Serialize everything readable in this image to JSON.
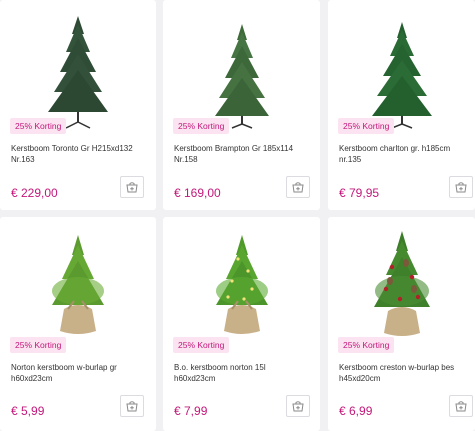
{
  "products": [
    {
      "name": "Kerstboom Toronto Gr H215xd132 Nr.163",
      "price": "€ 229,00",
      "badge": "25% Korting",
      "image": "artificial-christmas-tree-dark"
    },
    {
      "name": "Kerstboom Brampton Gr 185x114 Nr.158",
      "price": "€ 169,00",
      "badge": "25% Korting",
      "image": "artificial-christmas-tree"
    },
    {
      "name": "Kerstboom charlton gr. h185cm nr.135",
      "price": "€ 79,95",
      "badge": "25% Korting",
      "image": "artificial-christmas-tree"
    },
    {
      "name": "Norton kerstboom w-burlap gr h60xd23cm",
      "price": "€ 5,99",
      "badge": "25% Korting",
      "image": "mini-tree-burlap"
    },
    {
      "name": "B.o. kerstboom norton 15l h60xd23cm",
      "price": "€ 7,99",
      "badge": "25% Korting",
      "image": "mini-tree-burlap-lights"
    },
    {
      "name": "Kerstboom creston w-burlap bes h45xd20cm",
      "price": "€ 6,99",
      "badge": "25% Korting",
      "image": "mini-tree-burlap-berries"
    }
  ],
  "cart_icon": "add-to-cart-icon",
  "colors": {
    "accent": "#c2187a",
    "badge_bg": "#fbe3f1",
    "page_bg": "#f1f1f3"
  }
}
